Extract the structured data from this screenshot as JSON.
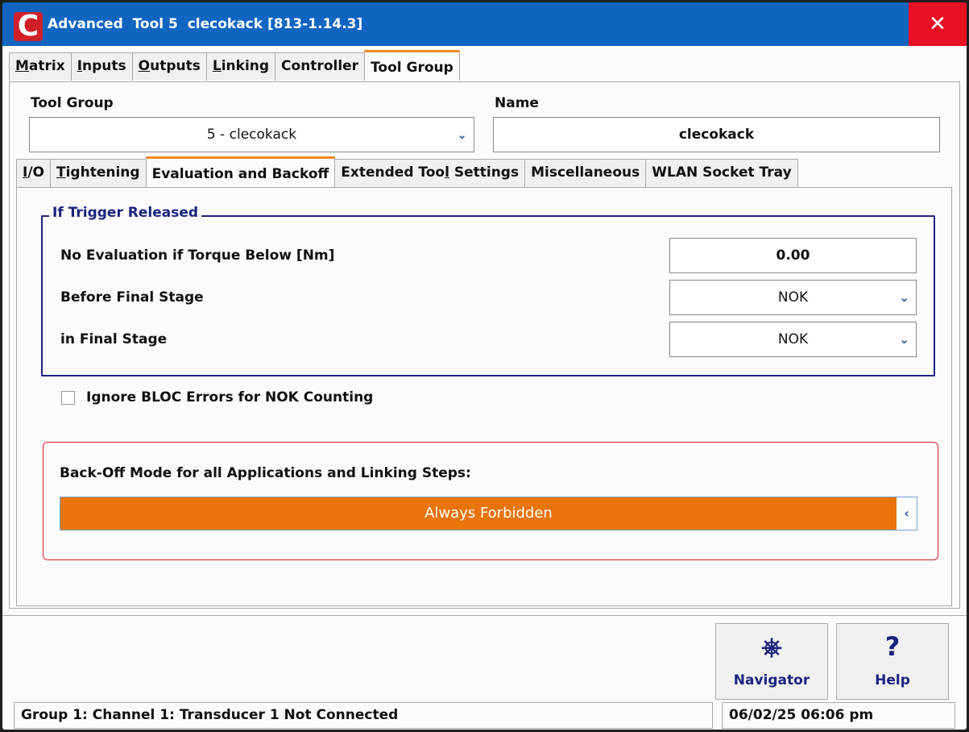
{
  "window": {
    "logo": "C",
    "title": "Advanced  Tool 5  clecokack [813-1.14.3]",
    "close": "✕"
  },
  "tabs_top": [
    {
      "pre": "",
      "ul": "M",
      "post": "atrix"
    },
    {
      "pre": "",
      "ul": "I",
      "post": "nputs"
    },
    {
      "pre": "",
      "ul": "O",
      "post": "utputs"
    },
    {
      "pre": "",
      "ul": "L",
      "post": "inking"
    },
    {
      "pre": "",
      "ul": "",
      "post": "Controller"
    },
    {
      "pre": "",
      "ul": "",
      "post": "Tool Group"
    }
  ],
  "tool_group": {
    "label": "Tool Group",
    "value": "5 - clecokack",
    "name_label": "Name",
    "name_value": "clecokack"
  },
  "tabs_inner": [
    {
      "pre": "",
      "ul": "I",
      "post": "/O"
    },
    {
      "pre": "",
      "ul": "T",
      "post": "ightening"
    },
    {
      "pre": "Evaluation and Backoff",
      "ul": "",
      "post": ""
    },
    {
      "pre": "Extended Too",
      "ul": "l",
      "post": " Settings"
    },
    {
      "pre": "Miscellaneous",
      "ul": "",
      "post": ""
    },
    {
      "pre": "WLAN Socket Tray",
      "ul": "",
      "post": ""
    }
  ],
  "trigger_group": {
    "title": "If Trigger Released",
    "row1_label": "No Evaluation if Torque Below [Nm]",
    "row1_value": "0.00",
    "row2_label": "Before Final Stage",
    "row2_value": "NOK",
    "row3_label": "in Final Stage",
    "row3_value": "NOK"
  },
  "ignore_bloc": {
    "label": "Ignore BLOC Errors for NOK Counting",
    "checked": false
  },
  "backoff": {
    "label": "Back-Off Mode for all Applications and Linking Steps:",
    "value": "Always Forbidden"
  },
  "buttons": {
    "navigator_icon": "⎈",
    "navigator": "Navigator",
    "help_icon": "?",
    "help": "Help"
  },
  "status": {
    "message": "Group 1: Channel 1: Transducer 1 Not Connected",
    "datetime": "06/02/25 06:06 pm"
  },
  "colors": {
    "titlebar": "#1065c0",
    "close": "#e81123",
    "tab_accent": "#f08a24",
    "backoff_select": "#e8740a",
    "group_border": "#1a237e",
    "highlight_border": "#d9212a"
  }
}
